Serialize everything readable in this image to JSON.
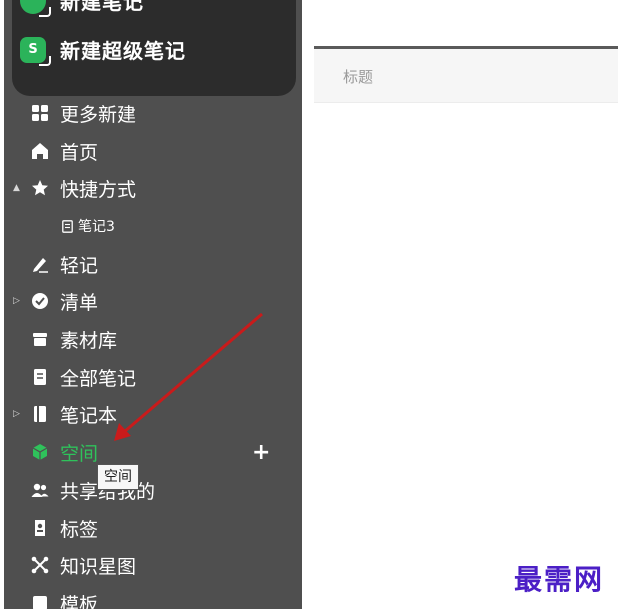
{
  "sidebar": {
    "top_actions": [
      {
        "label": "新建笔记",
        "icon": "green-note-icon"
      },
      {
        "label": "新建超级笔记",
        "icon": "super-note-s-icon",
        "badge": "S"
      }
    ],
    "items": [
      {
        "label": "更多新建",
        "icon": "grid-icon"
      },
      {
        "label": "首页",
        "icon": "home-icon"
      },
      {
        "label": "快捷方式",
        "icon": "star-icon",
        "expander": "▲"
      },
      {
        "label": "笔记3",
        "icon": "note-file-icon"
      },
      {
        "label": "轻记",
        "icon": "pen-icon"
      },
      {
        "label": "清单",
        "icon": "check-circle-icon",
        "expander": "▷"
      },
      {
        "label": "素材库",
        "icon": "box-icon"
      },
      {
        "label": "全部笔记",
        "icon": "notes-icon"
      },
      {
        "label": "笔记本",
        "icon": "notebook-icon",
        "expander": "▷"
      },
      {
        "label": "空间",
        "icon": "cube-icon"
      },
      {
        "label": "共享给我的",
        "icon": "people-icon"
      },
      {
        "label": "标签",
        "icon": "tag-icon"
      },
      {
        "label": "知识星图",
        "icon": "graph-icon"
      },
      {
        "label": "模板",
        "icon": "template-icon"
      }
    ],
    "plus_label": "+",
    "active_color": "#2fc25b"
  },
  "tooltip": {
    "text": "空间"
  },
  "main": {
    "title_placeholder": "标题"
  },
  "watermark": "最需网"
}
